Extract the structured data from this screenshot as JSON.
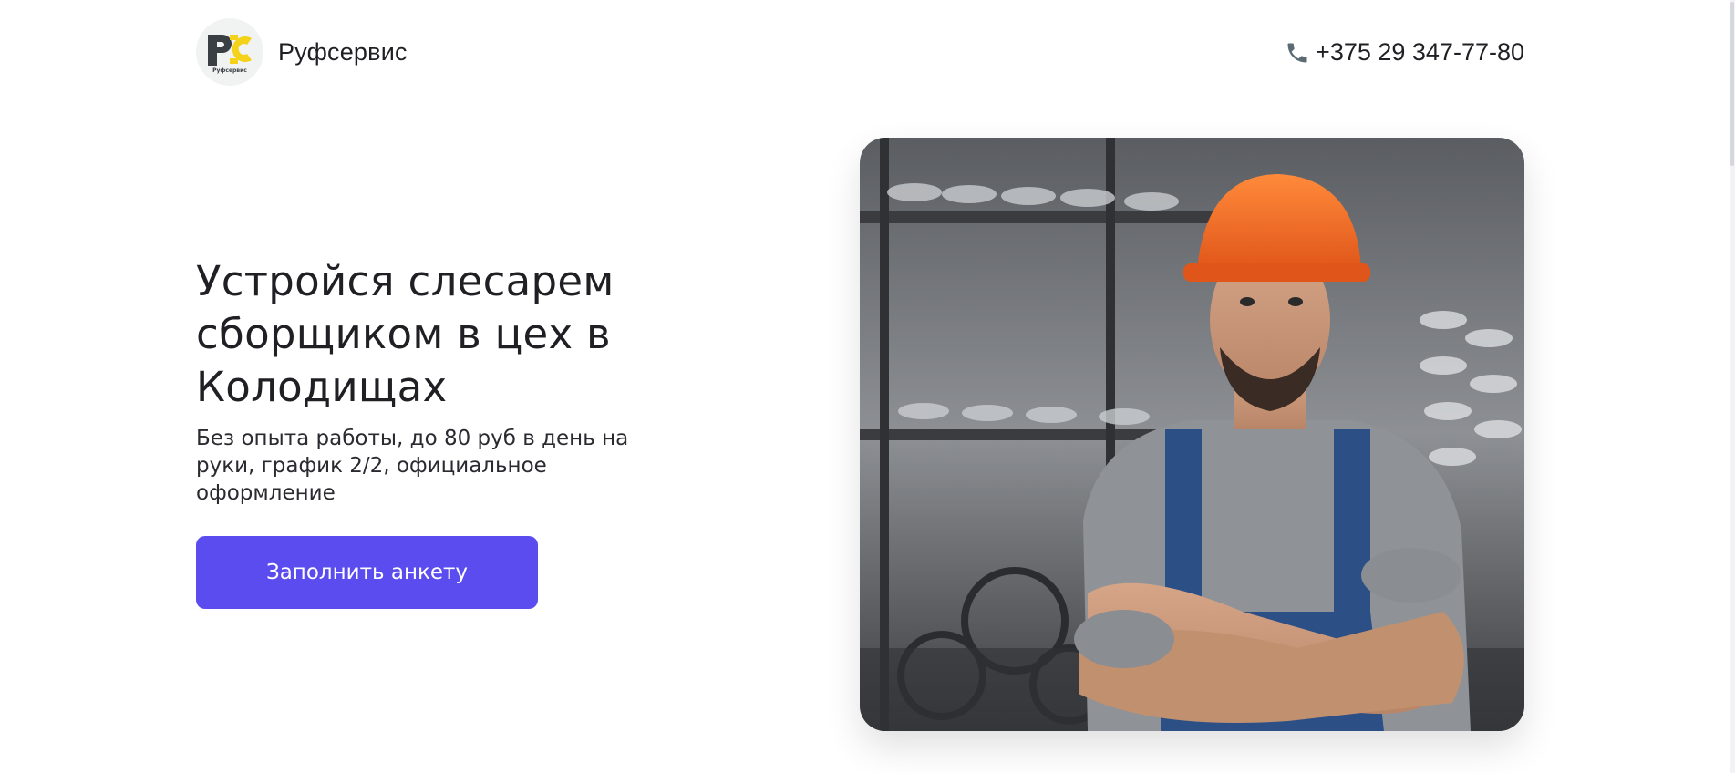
{
  "header": {
    "brand_name": "Руфсервис",
    "logo_caption": "Руфсервис",
    "logo_icon": "rs-logo-icon",
    "phone_icon": "phone-icon",
    "phone": "+375 29 347-77-80"
  },
  "hero": {
    "title": "Устройся слесарем сборщиком в цех в Колодищах",
    "subtitle": "Без опыта работы, до 80 руб в день на руки, график 2/2, официальное оформление",
    "cta_label": "Заполнить анкету"
  },
  "colors": {
    "accent": "#5b4cf0",
    "logo_yellow": "#f5d21a",
    "logo_dark": "#3a3f44"
  }
}
